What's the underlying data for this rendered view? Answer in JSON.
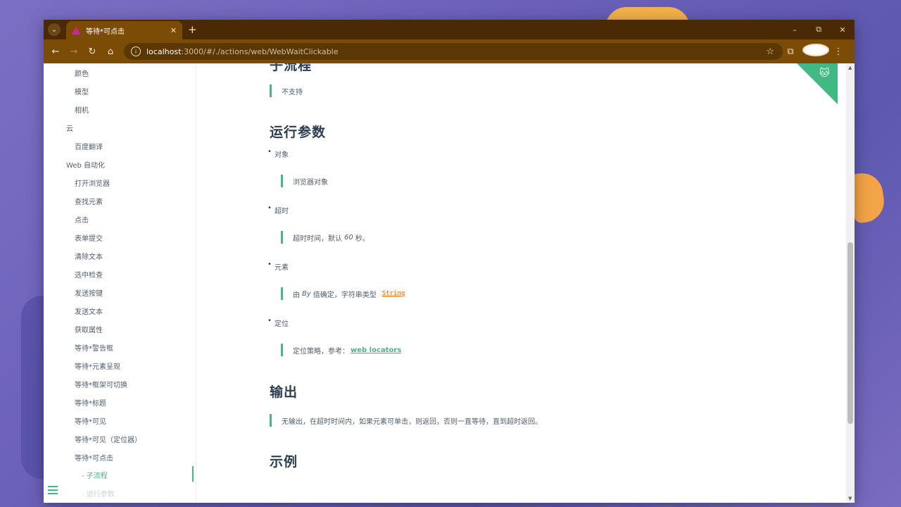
{
  "browser": {
    "tab_title": "等待*可点击",
    "new_tab": "+",
    "url_host": "localhost",
    "url_path": ":3000/#/./actions/web/WebWaitClickable",
    "window_controls": [
      "–",
      "⧉",
      "✕"
    ]
  },
  "sidebar": {
    "items": [
      {
        "label": "颜色",
        "level": 2
      },
      {
        "label": "模型",
        "level": 2
      },
      {
        "label": "相机",
        "level": 2
      },
      {
        "label": "云",
        "level": 1
      },
      {
        "label": "百度翻译",
        "level": 2
      },
      {
        "label": "Web 自动化",
        "level": 1
      },
      {
        "label": "打开浏览器",
        "level": 2
      },
      {
        "label": "查找元素",
        "level": 2
      },
      {
        "label": "点击",
        "level": 2
      },
      {
        "label": "表单提交",
        "level": 2
      },
      {
        "label": "清除文本",
        "level": 2
      },
      {
        "label": "选中检查",
        "level": 2
      },
      {
        "label": "发送按键",
        "level": 2
      },
      {
        "label": "发送文本",
        "level": 2
      },
      {
        "label": "获取属性",
        "level": 2
      },
      {
        "label": "等待*警告框",
        "level": 2
      },
      {
        "label": "等待*元素呈现",
        "level": 2
      },
      {
        "label": "等待*框架可切换",
        "level": 2
      },
      {
        "label": "等待*标题",
        "level": 2
      },
      {
        "label": "等待*可见",
        "level": 2
      },
      {
        "label": "等待*可见（定位器）",
        "level": 2
      },
      {
        "label": "等待*可点击",
        "level": 2
      },
      {
        "label": "- 子流程",
        "level": 3,
        "active": true
      },
      {
        "label": "- 运行参数",
        "level": 3
      }
    ]
  },
  "main": {
    "top_heading_partial": "子流程",
    "subflow_quote": "不支持",
    "params_heading": "运行参数",
    "params": [
      {
        "name": "对象",
        "desc": "浏览器对象"
      },
      {
        "name": "超时",
        "desc_pre": "超时时间，默认",
        "desc_em": "60",
        "desc_post": "秒。"
      },
      {
        "name": "元素",
        "desc_pre": "由",
        "desc_em": "By",
        "desc_mid": "值确定，字符串类型",
        "desc_code": "String"
      },
      {
        "name": "定位",
        "desc_pre": "定位策略，参考：",
        "desc_link": "web locators"
      }
    ],
    "output_heading": "输出",
    "output_quote": "无输出，在超时时间内，如果元素可单击，则返回，否则一直等待，直到超时返回。",
    "example_heading": "示例"
  },
  "colors": {
    "accent": "#42b983",
    "chrome_frame": "#7a4c05",
    "chrome_tabbar": "#4a2a05"
  }
}
